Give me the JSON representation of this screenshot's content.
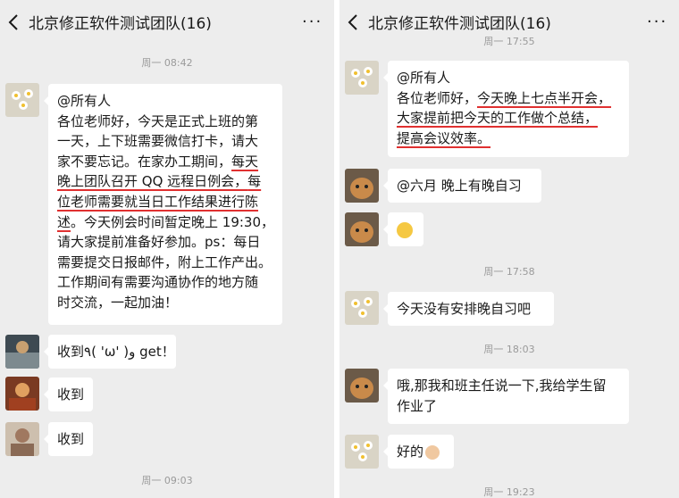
{
  "chat_title": "北京修正软件测试团队(16)",
  "more_label": "···",
  "left": {
    "time1": "周一 08:42",
    "announcement": {
      "line1": "@所有人",
      "line2": "各位老师好，今天是正式上班的第",
      "line3": "一天，上下班需要微信打卡，请大",
      "line4a": "家不要忘记。在家办工期间，",
      "line4b": "每天",
      "line5": "晚上团队召开 QQ 远程日例会，",
      "line5b": "每",
      "line6": "位老师需要就当日工作结果进行陈",
      "line7a": "述",
      "line7b": "。今天例会时间暂定晚上 19:30，",
      "line8": "请大家提前准备好参加。ps：每日",
      "line9": "需要提交日报邮件，附上工作产出。",
      "line10": "工作期间有需要沟通协作的地方随",
      "line11": "时交流，一起加油！"
    },
    "reply1": "收到٩( 'ω' )و get！",
    "reply2": "收到",
    "reply3": "收到",
    "time2": "周一 09:03"
  },
  "right": {
    "time0": "周一 17:55",
    "announcement": {
      "line1": "@所有人",
      "line2a": "各位老师好，",
      "line2b": "今天晚上七点半开会，",
      "line3": "大家提前把今天的工作做个总结，",
      "line4": "提高会议效率。"
    },
    "msg1": "@六月 晚上有晚自习",
    "time1": "周一 17:58",
    "msg2": "今天没有安排晚自习吧",
    "time2": "周一 18:03",
    "msg3_line1": "哦,那我和班主任说一下,我给学生留",
    "msg3_line2": "作业了",
    "msg4": "好的",
    "time3": "周一 19:23"
  }
}
